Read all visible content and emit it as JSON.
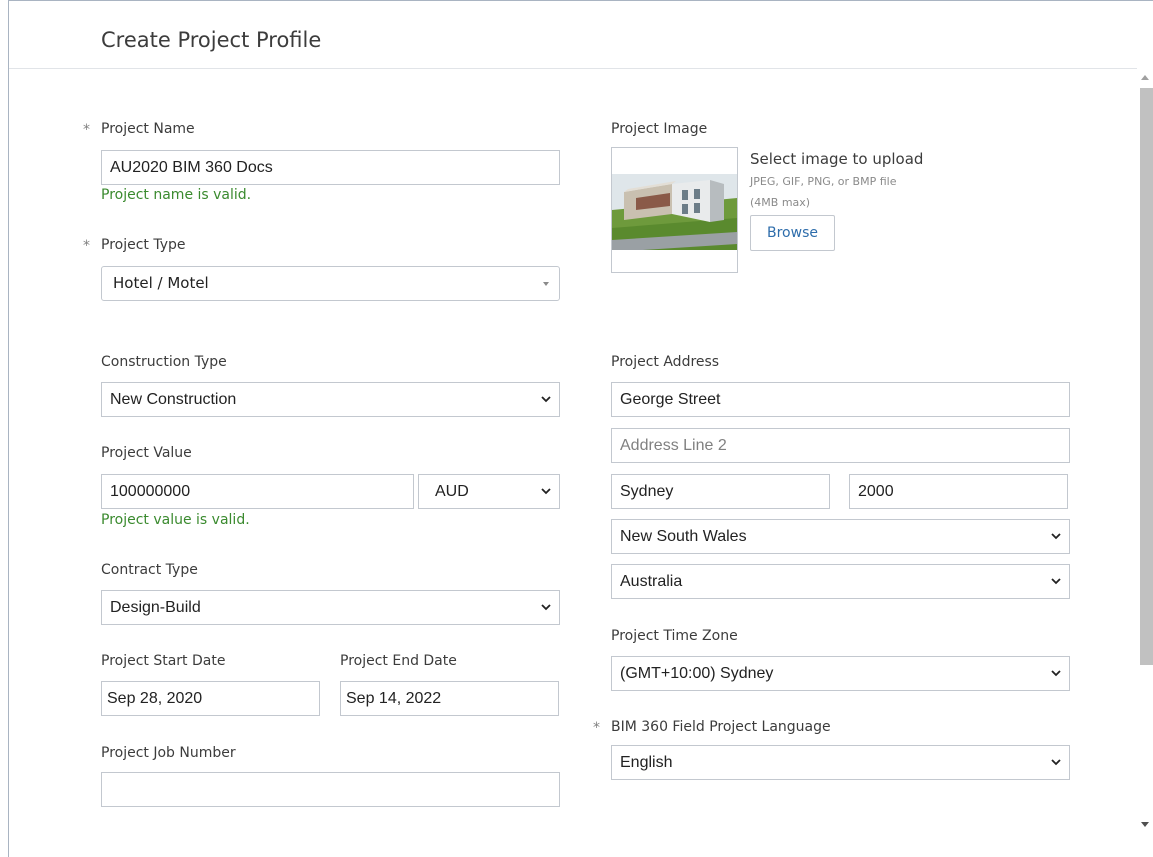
{
  "page": {
    "title": "Create Project Profile"
  },
  "left": {
    "project_name": {
      "label": "Project Name",
      "required": "*",
      "value": "AU2020 BIM 360 Docs",
      "valid_msg": "Project name is valid."
    },
    "project_type": {
      "label": "Project Type",
      "required": "*",
      "value": "Hotel / Motel"
    },
    "construction_type": {
      "label": "Construction Type",
      "value": "New Construction"
    },
    "project_value": {
      "label": "Project Value",
      "value": "100000000",
      "currency": "AUD",
      "valid_msg": "Project value is valid."
    },
    "contract_type": {
      "label": "Contract Type",
      "value": "Design-Build"
    },
    "start_date": {
      "label": "Project Start Date",
      "value": "Sep 28, 2020"
    },
    "end_date": {
      "label": "Project End Date",
      "value": "Sep 14, 2022"
    },
    "job_number": {
      "label": "Project Job Number",
      "value": ""
    }
  },
  "right": {
    "image": {
      "label": "Project Image",
      "upload_title": "Select image to upload",
      "hint_line1": "JPEG, GIF, PNG, or BMP file",
      "hint_line2": "(4MB max)",
      "browse_label": "Browse"
    },
    "address": {
      "label": "Project Address",
      "line1": "George Street",
      "line2_placeholder": "Address Line 2",
      "city": "Sydney",
      "postcode": "2000",
      "state": "New South Wales",
      "country": "Australia"
    },
    "time_zone": {
      "label": "Project Time Zone",
      "value": "(GMT+10:00) Sydney"
    },
    "language": {
      "label": "BIM 360 Field Project Language",
      "required": "*",
      "value": "English"
    }
  },
  "icons": {
    "select_chevron": "chevron-down-icon",
    "dropdown_caret": "caret-down-icon",
    "building_image": "building-thumbnail"
  }
}
